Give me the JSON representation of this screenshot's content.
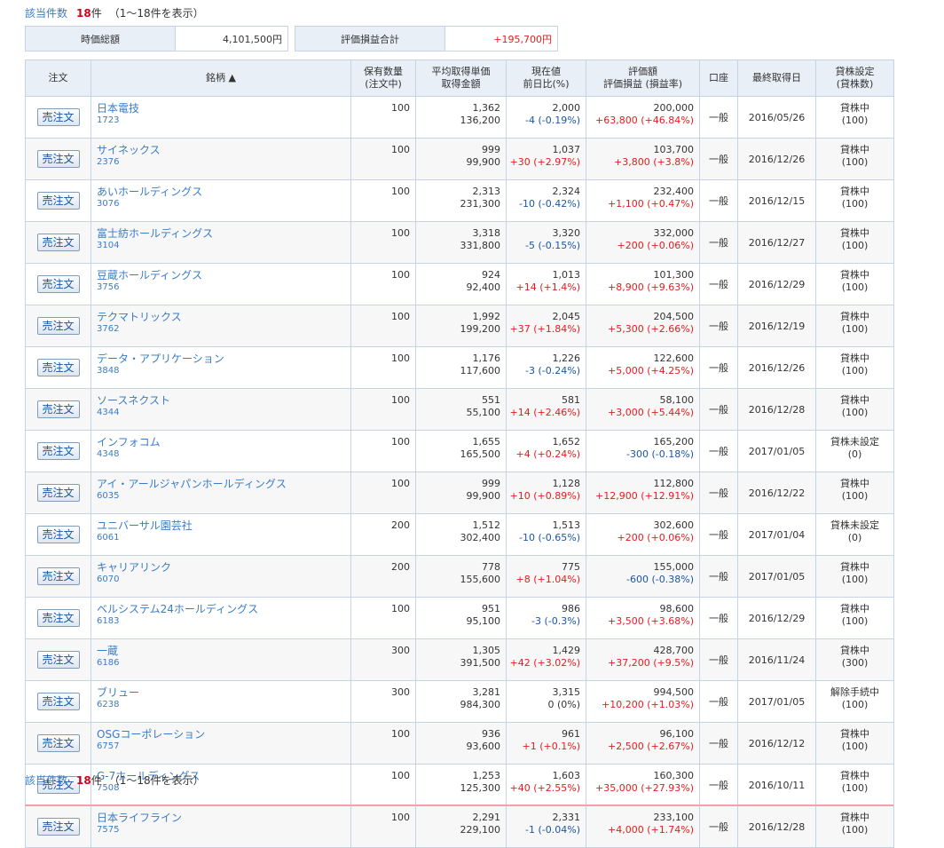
{
  "result_top": {
    "label": "該当件数",
    "count": "18",
    "unit": "件",
    "range": "（1〜18件を表示）"
  },
  "result_bottom": {
    "label": "該当件数",
    "count": "18",
    "unit": "件",
    "range": "（1〜18件を表示）"
  },
  "summary": {
    "market_value_label": "時価総額",
    "market_value": "4,101,500円",
    "unrealized_pl_label": "評価損益合計",
    "unrealized_pl": "+195,700円"
  },
  "headers": {
    "order": "注文",
    "name": "銘柄 ▲",
    "qty_1": "保有数量",
    "qty_2": "(注文中)",
    "avg_1": "平均取得単価",
    "avg_2": "取得金額",
    "price_1": "現在値",
    "price_2": "前日比(%)",
    "val_1": "評価額",
    "val_2": "評価損益 (損益率)",
    "account": "口座",
    "date": "最終取得日",
    "lend_1": "貸株設定",
    "lend_2": "(貸株数)"
  },
  "sell_label": "売注文",
  "rows": [
    {
      "name": "日本電技",
      "code": "1723",
      "qty": "100",
      "avg": "1,362",
      "cost": "136,200",
      "price": "2,000",
      "chg": "-4 (-0.19%)",
      "chg_c": "blue",
      "value": "200,000",
      "pl": "+63,800 (+46.84%)",
      "pl_c": "red",
      "acct": "一般",
      "date": "2016/05/26",
      "lend": "貸株中",
      "lend_qty": "(100)"
    },
    {
      "name": "サイネックス",
      "code": "2376",
      "qty": "100",
      "avg": "999",
      "cost": "99,900",
      "price": "1,037",
      "chg": "+30 (+2.97%)",
      "chg_c": "red",
      "value": "103,700",
      "pl": "+3,800 (+3.8%)",
      "pl_c": "red",
      "acct": "一般",
      "date": "2016/12/26",
      "lend": "貸株中",
      "lend_qty": "(100)"
    },
    {
      "name": "あいホールディングス",
      "code": "3076",
      "qty": "100",
      "avg": "2,313",
      "cost": "231,300",
      "price": "2,324",
      "chg": "-10 (-0.42%)",
      "chg_c": "blue",
      "value": "232,400",
      "pl": "+1,100 (+0.47%)",
      "pl_c": "red",
      "acct": "一般",
      "date": "2016/12/15",
      "lend": "貸株中",
      "lend_qty": "(100)"
    },
    {
      "name": "富士紡ホールディングス",
      "code": "3104",
      "qty": "100",
      "avg": "3,318",
      "cost": "331,800",
      "price": "3,320",
      "chg": "-5 (-0.15%)",
      "chg_c": "blue",
      "value": "332,000",
      "pl": "+200 (+0.06%)",
      "pl_c": "red",
      "acct": "一般",
      "date": "2016/12/27",
      "lend": "貸株中",
      "lend_qty": "(100)"
    },
    {
      "name": "豆蔵ホールディングス",
      "code": "3756",
      "qty": "100",
      "avg": "924",
      "cost": "92,400",
      "price": "1,013",
      "chg": "+14 (+1.4%)",
      "chg_c": "red",
      "value": "101,300",
      "pl": "+8,900 (+9.63%)",
      "pl_c": "red",
      "acct": "一般",
      "date": "2016/12/29",
      "lend": "貸株中",
      "lend_qty": "(100)"
    },
    {
      "name": "テクマトリックス",
      "code": "3762",
      "qty": "100",
      "avg": "1,992",
      "cost": "199,200",
      "price": "2,045",
      "chg": "+37 (+1.84%)",
      "chg_c": "red",
      "value": "204,500",
      "pl": "+5,300 (+2.66%)",
      "pl_c": "red",
      "acct": "一般",
      "date": "2016/12/19",
      "lend": "貸株中",
      "lend_qty": "(100)"
    },
    {
      "name": "データ・アプリケーション",
      "code": "3848",
      "qty": "100",
      "avg": "1,176",
      "cost": "117,600",
      "price": "1,226",
      "chg": "-3 (-0.24%)",
      "chg_c": "blue",
      "value": "122,600",
      "pl": "+5,000 (+4.25%)",
      "pl_c": "red",
      "acct": "一般",
      "date": "2016/12/26",
      "lend": "貸株中",
      "lend_qty": "(100)"
    },
    {
      "name": "ソースネクスト",
      "code": "4344",
      "qty": "100",
      "avg": "551",
      "cost": "55,100",
      "price": "581",
      "chg": "+14 (+2.46%)",
      "chg_c": "red",
      "value": "58,100",
      "pl": "+3,000 (+5.44%)",
      "pl_c": "red",
      "acct": "一般",
      "date": "2016/12/28",
      "lend": "貸株中",
      "lend_qty": "(100)"
    },
    {
      "name": "インフォコム",
      "code": "4348",
      "qty": "100",
      "avg": "1,655",
      "cost": "165,500",
      "price": "1,652",
      "chg": "+4 (+0.24%)",
      "chg_c": "red",
      "value": "165,200",
      "pl": "-300 (-0.18%)",
      "pl_c": "blue",
      "acct": "一般",
      "date": "2017/01/05",
      "lend": "貸株未設定",
      "lend_qty": "(0)"
    },
    {
      "name": "アイ・アールジャパンホールディングス",
      "code": "6035",
      "qty": "100",
      "avg": "999",
      "cost": "99,900",
      "price": "1,128",
      "chg": "+10 (+0.89%)",
      "chg_c": "red",
      "value": "112,800",
      "pl": "+12,900 (+12.91%)",
      "pl_c": "red",
      "acct": "一般",
      "date": "2016/12/22",
      "lend": "貸株中",
      "lend_qty": "(100)"
    },
    {
      "name": "ユニバーサル園芸社",
      "code": "6061",
      "qty": "200",
      "avg": "1,512",
      "cost": "302,400",
      "price": "1,513",
      "chg": "-10 (-0.65%)",
      "chg_c": "blue",
      "value": "302,600",
      "pl": "+200 (+0.06%)",
      "pl_c": "red",
      "acct": "一般",
      "date": "2017/01/04",
      "lend": "貸株未設定",
      "lend_qty": "(0)"
    },
    {
      "name": "キャリアリンク",
      "code": "6070",
      "qty": "200",
      "avg": "778",
      "cost": "155,600",
      "price": "775",
      "chg": "+8 (+1.04%)",
      "chg_c": "red",
      "value": "155,000",
      "pl": "-600 (-0.38%)",
      "pl_c": "blue",
      "acct": "一般",
      "date": "2017/01/05",
      "lend": "貸株中",
      "lend_qty": "(100)"
    },
    {
      "name": "ベルシステム24ホールディングス",
      "code": "6183",
      "qty": "100",
      "avg": "951",
      "cost": "95,100",
      "price": "986",
      "chg": "-3 (-0.3%)",
      "chg_c": "blue",
      "value": "98,600",
      "pl": "+3,500 (+3.68%)",
      "pl_c": "red",
      "acct": "一般",
      "date": "2016/12/29",
      "lend": "貸株中",
      "lend_qty": "(100)"
    },
    {
      "name": "一蔵",
      "code": "6186",
      "qty": "300",
      "avg": "1,305",
      "cost": "391,500",
      "price": "1,429",
      "chg": "+42 (+3.02%)",
      "chg_c": "red",
      "value": "428,700",
      "pl": "+37,200 (+9.5%)",
      "pl_c": "red",
      "acct": "一般",
      "date": "2016/11/24",
      "lend": "貸株中",
      "lend_qty": "(300)"
    },
    {
      "name": "ブリュー",
      "code": "6238",
      "qty": "300",
      "avg": "3,281",
      "cost": "984,300",
      "price": "3,315",
      "chg": "0 (0%)",
      "chg_c": "black",
      "value": "994,500",
      "pl": "+10,200 (+1.03%)",
      "pl_c": "red",
      "acct": "一般",
      "date": "2017/01/05",
      "lend": "解除手続中",
      "lend_qty": "(100)"
    },
    {
      "name": "OSGコーポレーション",
      "code": "6757",
      "qty": "100",
      "avg": "936",
      "cost": "93,600",
      "price": "961",
      "chg": "+1 (+0.1%)",
      "chg_c": "red",
      "value": "96,100",
      "pl": "+2,500 (+2.67%)",
      "pl_c": "red",
      "acct": "一般",
      "date": "2016/12/12",
      "lend": "貸株中",
      "lend_qty": "(100)"
    },
    {
      "name": "G-7ホールディングス",
      "code": "7508",
      "qty": "100",
      "avg": "1,253",
      "cost": "125,300",
      "price": "1,603",
      "chg": "+40 (+2.55%)",
      "chg_c": "red",
      "value": "160,300",
      "pl": "+35,000 (+27.93%)",
      "pl_c": "red",
      "acct": "一般",
      "date": "2016/10/11",
      "lend": "貸株中",
      "lend_qty": "(100)"
    },
    {
      "name": "日本ライフライン",
      "code": "7575",
      "qty": "100",
      "avg": "2,291",
      "cost": "229,100",
      "price": "2,331",
      "chg": "-1 (-0.04%)",
      "chg_c": "blue",
      "value": "233,100",
      "pl": "+4,000 (+1.74%)",
      "pl_c": "red",
      "acct": "一般",
      "date": "2016/12/28",
      "lend": "貸株中",
      "lend_qty": "(100)"
    }
  ]
}
